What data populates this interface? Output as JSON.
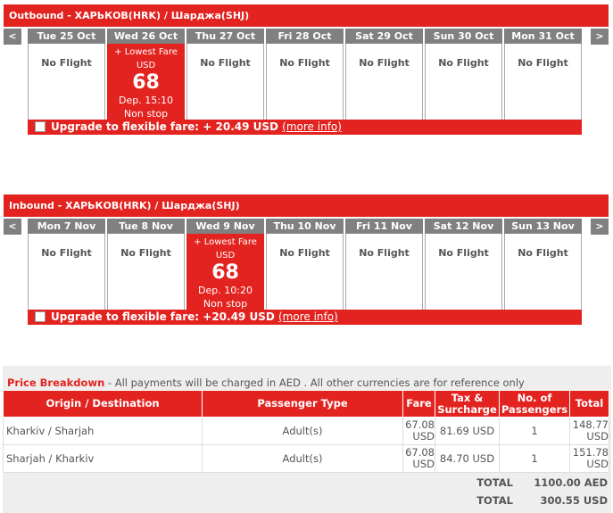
{
  "outbound": {
    "title": "Outbound - ХАРЬКОВ(HRK) / Шарджа(SHJ)",
    "prev": "<",
    "next": ">",
    "days": [
      {
        "date": "Tue 25 Oct",
        "status": "No Flight"
      },
      {
        "date": "Wed 26 Oct",
        "selected": true,
        "lowest": "+ Lowest Fare",
        "currency": "USD",
        "price": "68",
        "dep": "Dep. 15:10",
        "stops": "Non stop"
      },
      {
        "date": "Thu 27 Oct",
        "status": "No Flight"
      },
      {
        "date": "Fri 28 Oct",
        "status": "No Flight"
      },
      {
        "date": "Sat 29 Oct",
        "status": "No Flight"
      },
      {
        "date": "Sun 30 Oct",
        "status": "No Flight"
      },
      {
        "date": "Mon 31 Oct",
        "status": "No Flight"
      }
    ],
    "upgrade": "Upgrade to flexible fare: + 20.49 USD",
    "more": "(more info)"
  },
  "inbound": {
    "title": "Inbound - ХАРЬКОВ(HRK) / Шарджа(SHJ)",
    "prev": "<",
    "next": ">",
    "days": [
      {
        "date": "Mon 7 Nov",
        "status": "No Flight"
      },
      {
        "date": "Tue 8 Nov",
        "status": "No Flight"
      },
      {
        "date": "Wed 9 Nov",
        "selected": true,
        "lowest": "+ Lowest Fare",
        "currency": "USD",
        "price": "68",
        "dep": "Dep. 10:20",
        "stops": "Non stop"
      },
      {
        "date": "Thu 10 Nov",
        "status": "No Flight"
      },
      {
        "date": "Fri 11 Nov",
        "status": "No Flight"
      },
      {
        "date": "Sat 12 Nov",
        "status": "No Flight"
      },
      {
        "date": "Sun 13 Nov",
        "status": "No Flight"
      }
    ],
    "upgrade": "Upgrade to flexible fare: +20.49 USD",
    "more": "(more info)"
  },
  "price": {
    "title": "Price Breakdown",
    "note": " - All payments will be charged in AED . All other currencies are for reference only",
    "headers": [
      "Origin / Destination",
      "Passenger Type",
      "Fare",
      "Tax & Surcharge",
      "No. of Passengers",
      "Total"
    ],
    "rows": [
      [
        "Kharkiv / Sharjah",
        "Adult(s)",
        "67.08 USD",
        "81.69 USD",
        "1",
        "148.77 USD"
      ],
      [
        "Sharjah / Kharkiv",
        "Adult(s)",
        "67.08 USD",
        "84.70 USD",
        "1",
        "151.78 USD"
      ]
    ],
    "totals": [
      {
        "label": "TOTAL",
        "value": "1100.00 AED"
      },
      {
        "label": "TOTAL",
        "value": "300.55 USD"
      }
    ]
  }
}
